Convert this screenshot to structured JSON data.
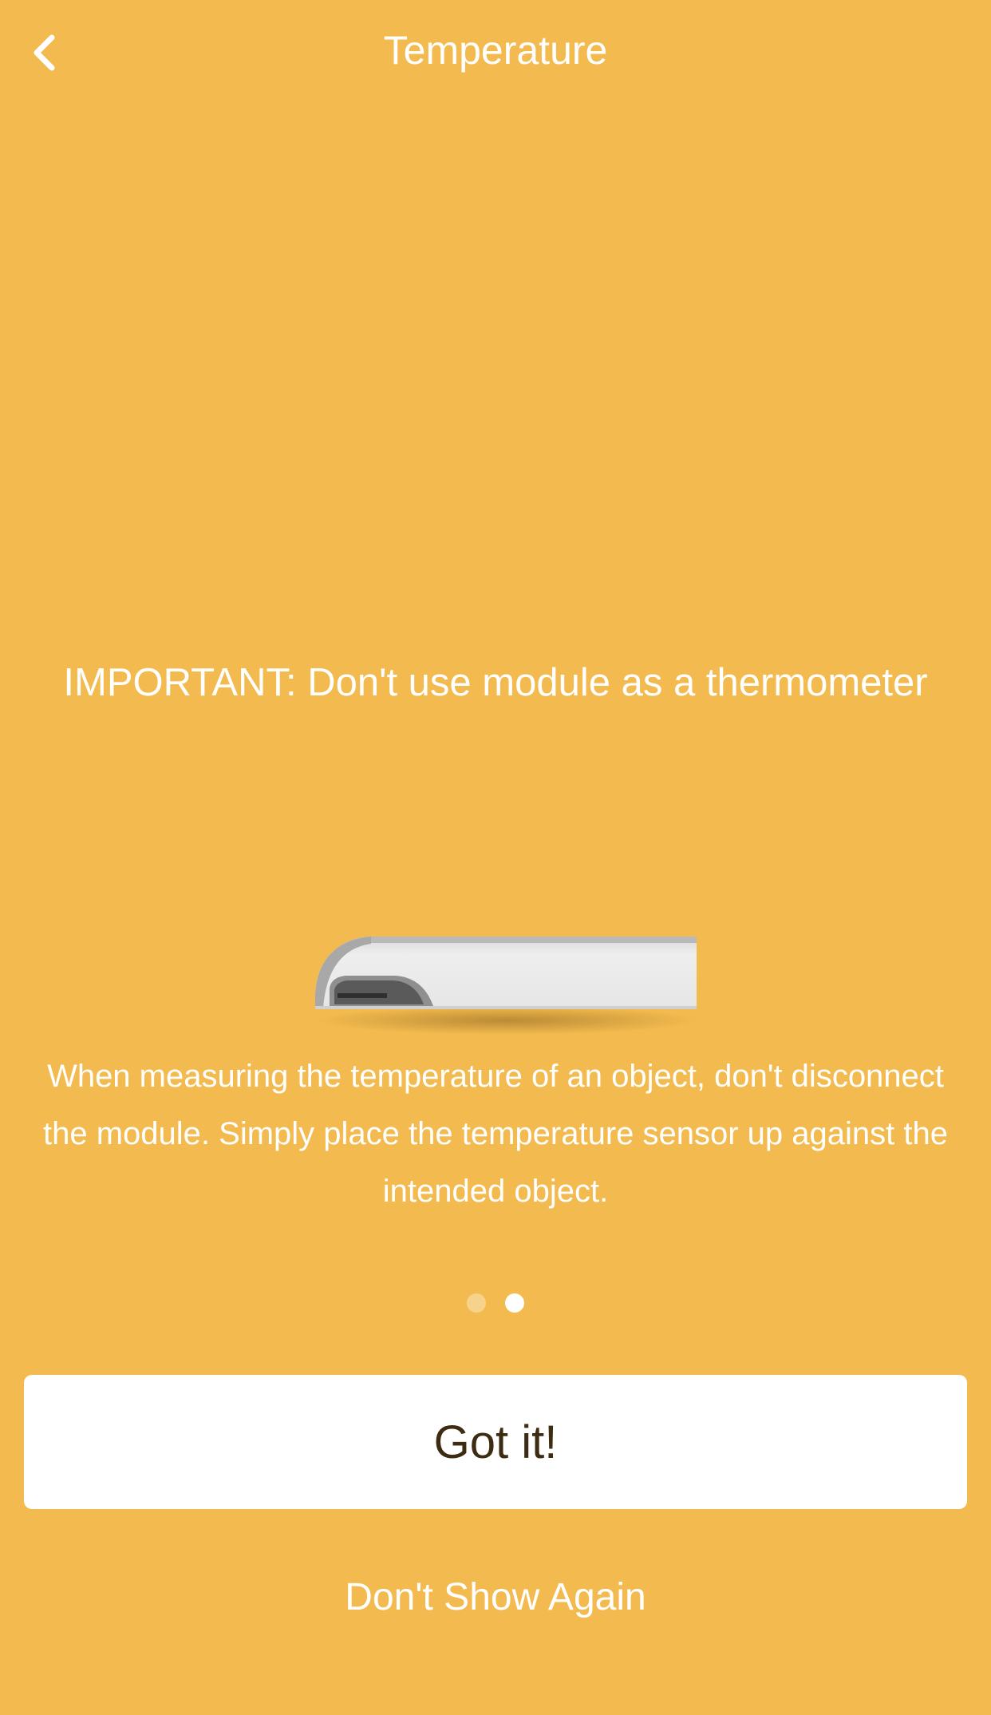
{
  "header": {
    "title": "Temperature",
    "back_icon": "chevron-left-icon"
  },
  "content": {
    "important": "IMPORTANT: Don't use module as a thermometer",
    "description": "When measuring the temperature of an object, don't disconnect the module. Simply place the temperature sensor up against the intended object.",
    "device_image": "temperature-module-illustration"
  },
  "pagination": {
    "total": 2,
    "current": 2
  },
  "actions": {
    "primary_label": "Got it!",
    "secondary_label": "Don't Show Again"
  },
  "colors": {
    "background": "#F3BB4F",
    "text": "#FFFFFF",
    "button_bg": "#FFFFFF",
    "button_text": "#3D2C12"
  }
}
